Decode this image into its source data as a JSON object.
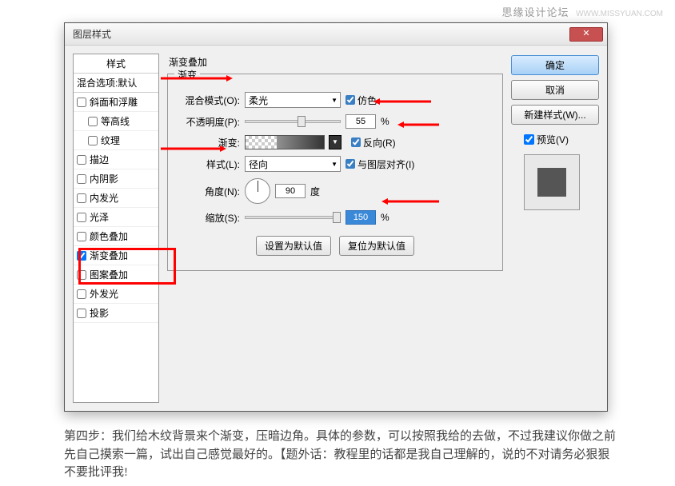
{
  "watermark": {
    "text": "思缘设计论坛",
    "url": "WWW.MISSYUAN.COM"
  },
  "dialog": {
    "title": "图层样式",
    "styles": {
      "header": "样式",
      "blending": "混合选项:默认",
      "items": [
        {
          "label": "斜面和浮雕",
          "checked": false,
          "indent": false
        },
        {
          "label": "等高线",
          "checked": false,
          "indent": true
        },
        {
          "label": "纹理",
          "checked": false,
          "indent": true
        },
        {
          "label": "描边",
          "checked": false,
          "indent": false
        },
        {
          "label": "内阴影",
          "checked": false,
          "indent": false
        },
        {
          "label": "内发光",
          "checked": false,
          "indent": false
        },
        {
          "label": "光泽",
          "checked": false,
          "indent": false
        },
        {
          "label": "颜色叠加",
          "checked": false,
          "indent": false
        },
        {
          "label": "渐变叠加",
          "checked": true,
          "indent": false,
          "highlight": true
        },
        {
          "label": "图案叠加",
          "checked": false,
          "indent": false
        },
        {
          "label": "外发光",
          "checked": false,
          "indent": false
        },
        {
          "label": "投影",
          "checked": false,
          "indent": false
        }
      ]
    },
    "gradient": {
      "panel_title": "渐变叠加",
      "group_label": "渐变",
      "blend_mode_label": "混合模式(O):",
      "blend_mode_value": "柔光",
      "dither_label": "仿色",
      "opacity_label": "不透明度(P):",
      "opacity_value": "55",
      "opacity_unit": "%",
      "gradient_label": "渐变:",
      "reverse_label": "反向(R)",
      "style_label": "样式(L):",
      "style_value": "径向",
      "align_label": "与图层对齐(I)",
      "angle_label": "角度(N):",
      "angle_value": "90",
      "angle_unit": "度",
      "scale_label": "缩放(S):",
      "scale_value": "150",
      "scale_unit": "%",
      "set_default": "设置为默认值",
      "reset_default": "复位为默认值"
    },
    "actions": {
      "ok": "确定",
      "cancel": "取消",
      "new_style": "新建样式(W)...",
      "preview": "预览(V)"
    }
  },
  "caption": "第四步：我们给木纹背景来个渐变，压暗边角。具体的参数，可以按照我给的去做，不过我建议你做之前先自己摸索一篇，试出自己感觉最好的。【题外话：教程里的话都是我自己理解的，说的不对请务必狠狠不要批评我!"
}
